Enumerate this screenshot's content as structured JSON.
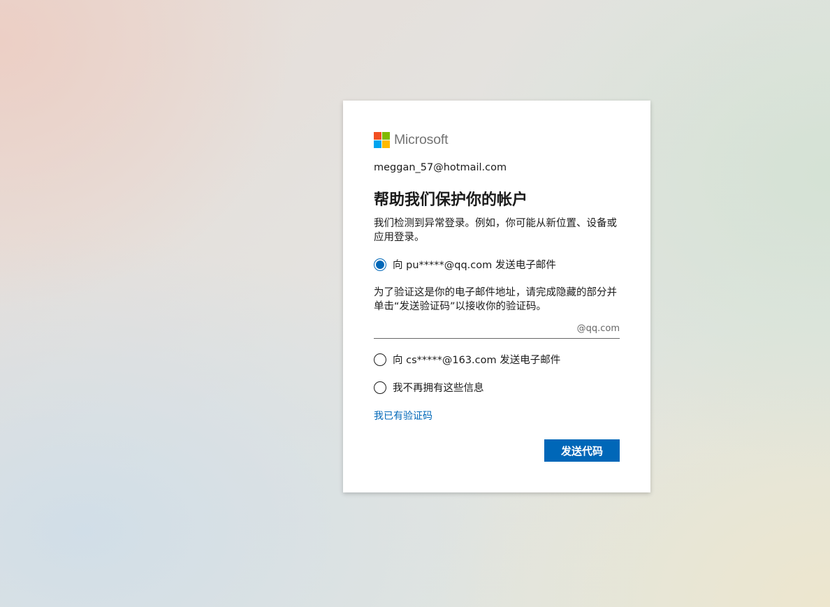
{
  "brand": {
    "logo_text": "Microsoft",
    "logo_colors": [
      "#f25022",
      "#7fba00",
      "#00a4ef",
      "#ffb900"
    ]
  },
  "identity": "meggan_57@hotmail.com",
  "title": "帮助我们保护你的帐户",
  "description": "我们检测到异常登录。例如，你可能从新位置、设备或应用登录。",
  "options": [
    {
      "label": "向 pu*****@qq.com 发送电子邮件",
      "checked": true
    },
    {
      "label": "向 cs*****@163.com 发送电子邮件",
      "checked": false
    },
    {
      "label": "我不再拥有这些信息",
      "checked": false
    }
  ],
  "verify_instructions": "为了验证这是你的电子邮件地址，请完成隐藏的部分并单击“发送验证码”以接收你的验证码。",
  "email_input": {
    "value": "",
    "suffix": "@qq.com"
  },
  "have_code_link": "我已有验证码",
  "send_button": "发送代码",
  "colors": {
    "accent": "#0067b8"
  }
}
